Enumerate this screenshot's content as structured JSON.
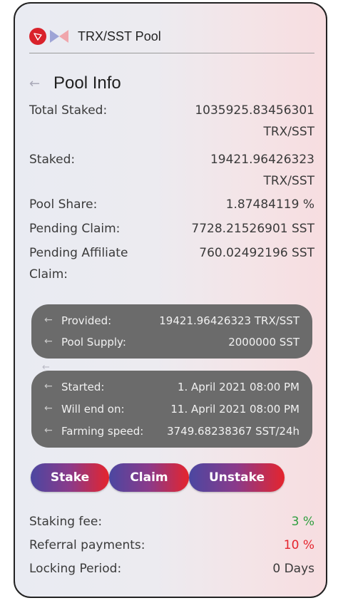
{
  "header": {
    "title": "TRX/SST Pool",
    "icons": [
      "tron-logo-icon",
      "sst-logo-icon"
    ]
  },
  "section": {
    "back_icon": "arrow-left-icon",
    "title": "Pool Info"
  },
  "info": {
    "total_staked": {
      "label": "Total Staked:",
      "value": "1035925.83456301",
      "unit": "TRX/SST"
    },
    "staked": {
      "label": "Staked:",
      "value": "19421.96426323",
      "unit": "TRX/SST"
    },
    "pool_share": {
      "label": "Pool Share:",
      "value": "1.87484119 %"
    },
    "pending_claim": {
      "label": "Pending Claim:",
      "value": "7728.21526901 SST"
    },
    "pending_affiliate": {
      "label_line1": "Pending Affiliate",
      "label_line2": "Claim:",
      "value": "760.02492196 SST"
    }
  },
  "box1": {
    "provided": {
      "label": "Provided:",
      "value": "19421.96426323 TRX/SST"
    },
    "pool_supply": {
      "label": "Pool Supply:",
      "value": "2000000 SST"
    }
  },
  "box2": {
    "started": {
      "label": "Started:",
      "value": "1. April 2021 08:00 PM"
    },
    "will_end_on": {
      "label": "Will end on:",
      "value": "11. April 2021 08:00 PM"
    },
    "farming_speed": {
      "label": "Farming speed:",
      "value": "3749.68238367 SST/24h"
    }
  },
  "buttons": {
    "stake": "Stake",
    "claim": "Claim",
    "unstake": "Unstake"
  },
  "fees": {
    "staking_fee": {
      "label": "Staking fee:",
      "value": "3 %"
    },
    "referral_payments": {
      "label": "Referral payments:",
      "value": "10 %"
    },
    "locking_period": {
      "label": "Locking Period:",
      "value": "0 Days"
    }
  },
  "colors": {
    "green_value": "#2f9e3f",
    "red_value": "#e5242d",
    "button_gradient_start": "#4b47a1",
    "button_gradient_end": "#e5242d",
    "dark_box": "#6b6b6b"
  }
}
